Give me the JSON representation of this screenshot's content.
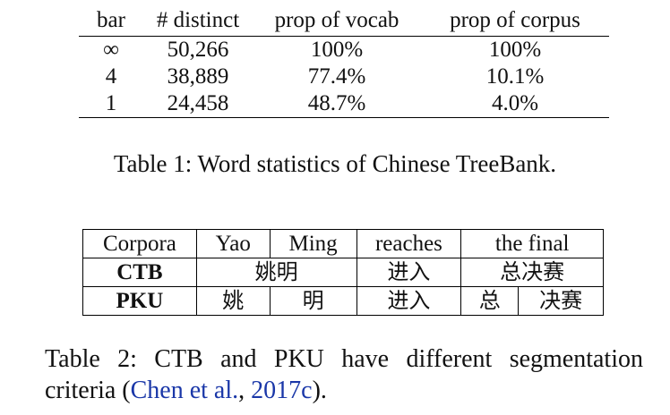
{
  "table1": {
    "headers": [
      "bar",
      "# distinct",
      "prop of vocab",
      "prop of corpus"
    ],
    "rows": [
      [
        "∞",
        "50,266",
        "100%",
        "100%"
      ],
      [
        "4",
        "38,889",
        "77.4%",
        "10.1%"
      ],
      [
        "1",
        "24,458",
        "48.7%",
        "4.0%"
      ]
    ],
    "caption": "Table 1: Word statistics of Chinese TreeBank."
  },
  "table2": {
    "headers": [
      "Corpora",
      "Yao",
      "Ming",
      "reaches",
      "the final"
    ],
    "ctb": {
      "label": "CTB",
      "seg1": "姚明",
      "seg2": "进入",
      "seg3": "总决赛"
    },
    "pku": {
      "label": "PKU",
      "seg1": "姚",
      "seg2": "明",
      "seg3": "进入",
      "seg4": "总",
      "seg5": "决赛"
    },
    "caption_line1": "Table 2: CTB and PKU have different segmentation",
    "caption_line2_pre": "criteria (",
    "caption_cite_author": "Chen et al.",
    "caption_cite_sep": ", ",
    "caption_cite_year": "2017c",
    "caption_line2_post": ")."
  }
}
